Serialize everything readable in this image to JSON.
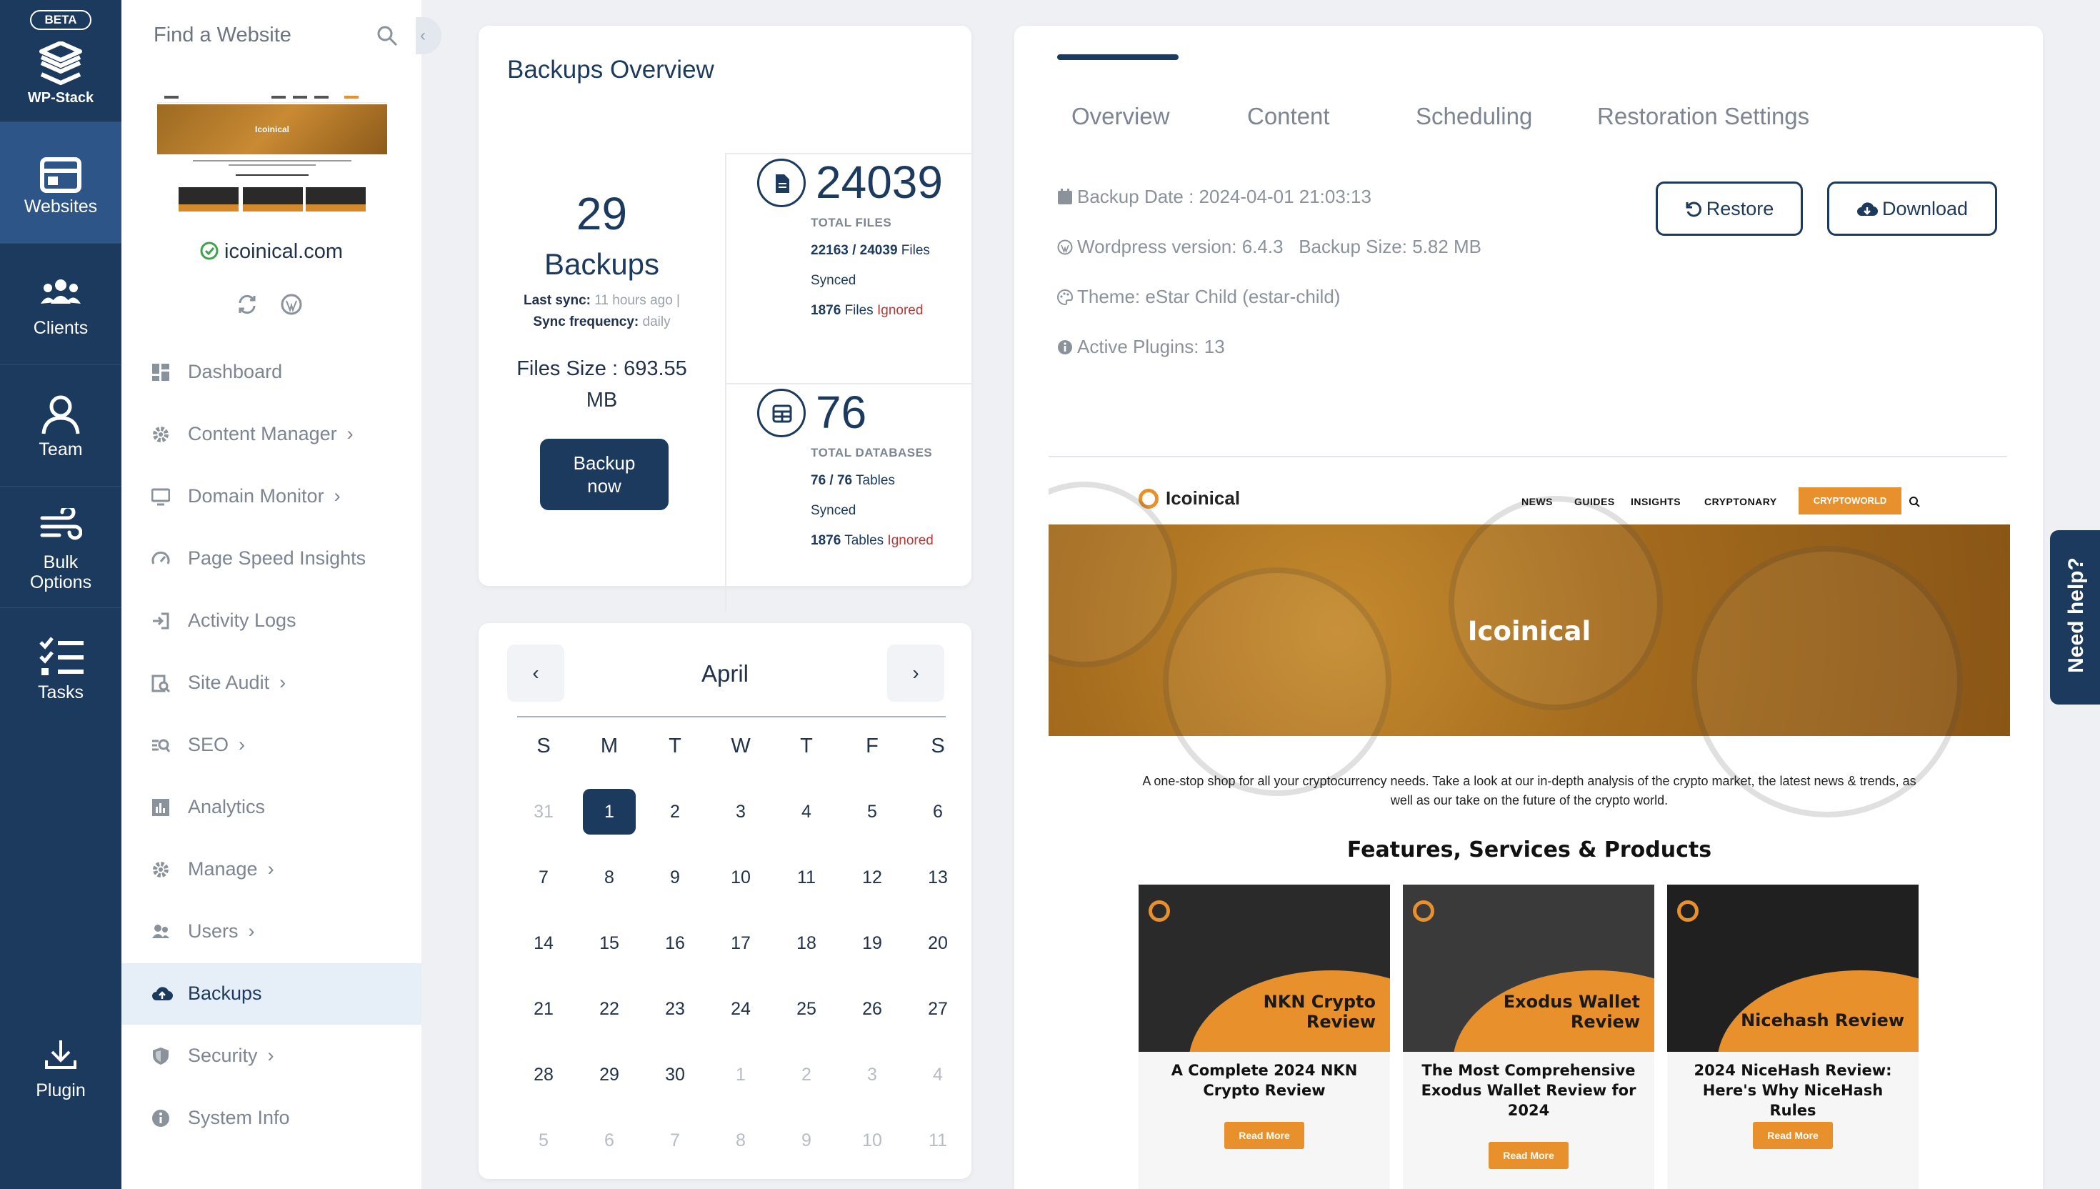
{
  "rail": {
    "beta": "BETA",
    "brand": "WP-Stack",
    "items": [
      {
        "label": "Websites",
        "icon": "websites-icon"
      },
      {
        "label": "Clients",
        "icon": "clients-icon"
      },
      {
        "label": "Team",
        "icon": "team-icon"
      },
      {
        "label_line1": "Bulk",
        "label_line2": "Options",
        "icon": "wind-icon"
      },
      {
        "label": "Tasks",
        "icon": "tasks-icon"
      },
      {
        "label": "Plugin",
        "icon": "download-icon"
      }
    ]
  },
  "sidebar": {
    "search_placeholder": "Find a Website",
    "site_name": "icoinical.com",
    "thumb_title": "Icoinical",
    "nav": [
      {
        "label": "Dashboard",
        "chevron": false
      },
      {
        "label": "Content Manager",
        "chevron": true
      },
      {
        "label": "Domain Monitor",
        "chevron": true
      },
      {
        "label": "Page Speed Insights",
        "chevron": false
      },
      {
        "label": "Activity Logs",
        "chevron": false
      },
      {
        "label": "Site Audit",
        "chevron": true
      },
      {
        "label": "SEO",
        "chevron": true
      },
      {
        "label": "Analytics",
        "chevron": false
      },
      {
        "label": "Manage",
        "chevron": true
      },
      {
        "label": "Users",
        "chevron": true
      },
      {
        "label": "Backups",
        "chevron": false,
        "active": true
      },
      {
        "label": "Security",
        "chevron": true
      },
      {
        "label": "System Info",
        "chevron": false
      }
    ]
  },
  "overview": {
    "title": "Backups Overview",
    "backups_count": "29",
    "backups_label": "Backups",
    "last_sync_label": "Last sync:",
    "last_sync_value": "11 hours ago |",
    "sync_freq_label": "Sync frequency:",
    "sync_freq_value": "daily",
    "files_size_line1": "Files Size : 693.55",
    "files_size_line2": "MB",
    "backup_btn_line1": "Backup",
    "backup_btn_line2": "now",
    "total_files": "24039",
    "total_files_label": "TOTAL FILES",
    "files_synced_ratio": "22163 / 24039",
    "files_word": "Files",
    "synced_word": "Synced",
    "files_ignored_count": "1876",
    "ignored_word": "Ignored",
    "total_db": "76",
    "total_db_label": "TOTAL DATABASES",
    "tables_synced_ratio": "76 / 76",
    "tables_word": "Tables",
    "tables_ignored_count": "1876"
  },
  "calendar": {
    "month": "April",
    "prev": "‹",
    "next": "›",
    "weekdays": [
      "S",
      "M",
      "T",
      "W",
      "T",
      "F",
      "S"
    ],
    "weeks": [
      [
        "31",
        "1",
        "2",
        "3",
        "4",
        "5",
        "6"
      ],
      [
        "7",
        "8",
        "9",
        "10",
        "11",
        "12",
        "13"
      ],
      [
        "14",
        "15",
        "16",
        "17",
        "18",
        "19",
        "20"
      ],
      [
        "21",
        "22",
        "23",
        "24",
        "25",
        "26",
        "27"
      ],
      [
        "28",
        "29",
        "30",
        "1",
        "2",
        "3",
        "4"
      ],
      [
        "5",
        "6",
        "7",
        "8",
        "9",
        "10",
        "11"
      ]
    ],
    "selected": "1"
  },
  "detail": {
    "tabs": [
      "Overview",
      "Content",
      "Scheduling",
      "Restoration Settings"
    ],
    "backup_date": "Backup Date : 2024-04-01 21:03:13",
    "wp_version": "Wordpress version: 6.4.3",
    "backup_size": "Backup Size: 5.82 MB",
    "theme": "Theme: eStar Child (estar-child)",
    "plugins": "Active Plugins: 13",
    "restore_btn": "Restore",
    "download_btn": "Download"
  },
  "preview": {
    "logo": "Icoinical",
    "nav": [
      "NEWS",
      "GUIDES",
      "INSIGHTS",
      "CRYPTONARY"
    ],
    "cta": "CRYPTOWORLD",
    "hero_title": "Icoinical",
    "desc": "A one-stop shop for all your cryptocurrency needs. Take a look at our in-depth analysis of the crypto market, the latest news & trends, as well as our take on the future of the crypto world.",
    "section_title": "Features, Services & Products",
    "cards": [
      {
        "img_title_1": "NKN Crypto",
        "img_title_2": "Review",
        "caption": "A Complete 2024 NKN Crypto Review",
        "button": "Read More"
      },
      {
        "img_title_1": "Exodus Wallet",
        "img_title_2": "Review",
        "caption": "The Most Comprehensive Exodus Wallet Review for 2024",
        "button": "Read More"
      },
      {
        "img_title_1": "",
        "img_title_2": "Nicehash Review",
        "caption": "2024 NiceHash Review: Here's Why NiceHash Rules",
        "button": "Read More"
      }
    ]
  },
  "help": "Need help?"
}
